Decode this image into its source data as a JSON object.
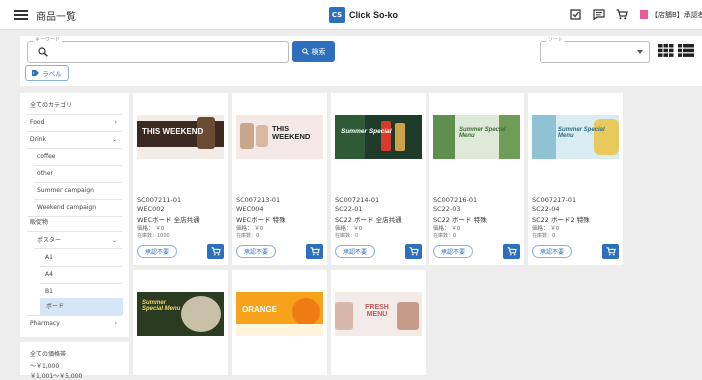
{
  "header": {
    "title": "商品一覧",
    "brand_logo": "CS",
    "brand_name": "Click So-ko",
    "user": "【店舗B】承認者"
  },
  "search": {
    "keyword_label": "キーワード",
    "button_label": "検索",
    "sort_label": "ソート",
    "label_button": "ラベル"
  },
  "sidebar": {
    "all_categories": "全てのカテゴリ",
    "food": "Food",
    "drink": "Drink",
    "coffee": "coffee",
    "other": "other",
    "summer": "Summer campaign",
    "weekend": "Weekend campaign",
    "sales_promo": "販促物",
    "poster": "ポスター",
    "a1": "A1",
    "a4": "A4",
    "b1": "B1",
    "board": "ボード",
    "pharmacy": "Pharmacy"
  },
  "price_filter": {
    "title": "全ての価格帯",
    "item1": "～￥1,000",
    "item2": "￥1,001～￥5,000"
  },
  "products": [
    {
      "code": "SC007211-01",
      "code2": "WEC002",
      "name": "WECボード 全店共通",
      "price": "価格： ￥0",
      "stock": "在庫数：1000",
      "status": "承認不要",
      "banner": "THIS WEEKEND"
    },
    {
      "code": "SC007213-01",
      "code2": "WEC004",
      "name": "WECボード 特殊",
      "price": "価格： ￥0",
      "stock": "在庫数：0",
      "status": "承認不要",
      "banner": "THIS WEEKEND"
    },
    {
      "code": "SC007214-01",
      "code2": "SC22-01",
      "name": "SC22 ボード 全店共通",
      "price": "価格： ￥0",
      "stock": "在庫数：0",
      "status": "承認不要",
      "banner": "Summer Special"
    },
    {
      "code": "SC007216-01",
      "code2": "SC22-03",
      "name": "SC22 ボード 特殊",
      "price": "価格： ￥0",
      "stock": "在庫数：0",
      "status": "承認不要",
      "banner": "Summer Special Menu"
    },
    {
      "code": "SC007217-01",
      "code2": "SC22-04",
      "name": "SC22 ボード2 特殊",
      "price": "価格： ￥0",
      "stock": "在庫数：0",
      "status": "承認不要",
      "banner": "Summer Special Menu"
    },
    {
      "banner": "Summer Special Menu"
    },
    {
      "banner": "ORANGE"
    },
    {
      "banner": "FRESH MENU"
    }
  ],
  "colors": {
    "accent": "#2d6fbd",
    "user_badge": "#e65b9a"
  }
}
